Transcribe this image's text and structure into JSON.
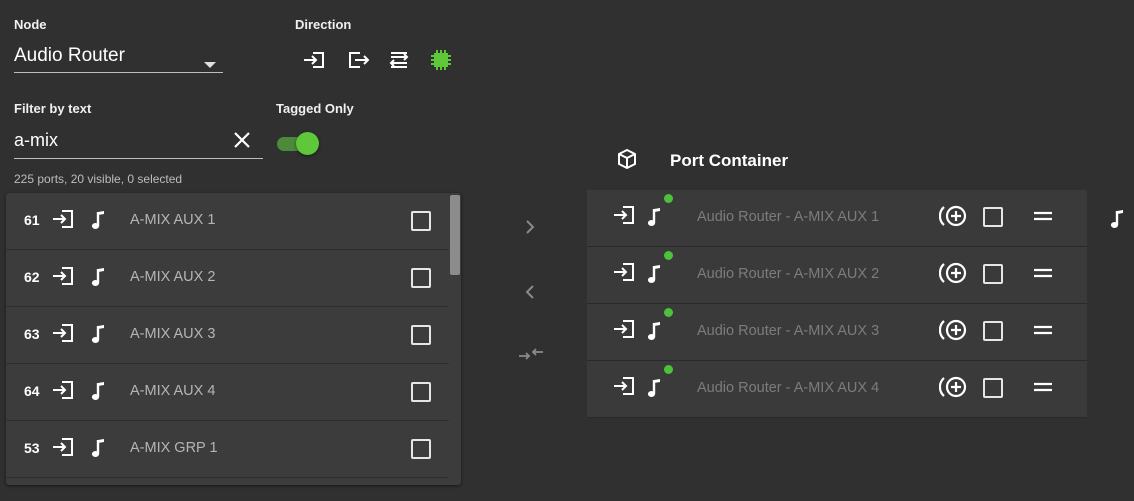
{
  "node": {
    "label": "Node",
    "value": "Audio Router"
  },
  "direction": {
    "label": "Direction",
    "options": [
      "input-icon",
      "output-icon",
      "bidirectional-icon",
      "chip-icon"
    ]
  },
  "filter": {
    "label": "Filter by text",
    "value": "a-mix"
  },
  "tagged_only": {
    "label": "Tagged Only",
    "on": true
  },
  "summary": "225 ports, 20 visible, 0 selected",
  "left_list": [
    {
      "number": "61",
      "name": "A-MIX AUX 1"
    },
    {
      "number": "62",
      "name": "A-MIX AUX 2"
    },
    {
      "number": "63",
      "name": "A-MIX AUX 3"
    },
    {
      "number": "64",
      "name": "A-MIX AUX 4"
    },
    {
      "number": "53",
      "name": "A-MIX GRP 1"
    }
  ],
  "port_container": {
    "title": "Port Container",
    "rows": [
      {
        "name": "Audio Router - A-MIX AUX 1"
      },
      {
        "name": "Audio Router - A-MIX AUX 2"
      },
      {
        "name": "Audio Router - A-MIX AUX 3"
      },
      {
        "name": "Audio Router - A-MIX AUX 4"
      }
    ]
  },
  "colors": {
    "accent": "#5fc83a",
    "background": "#303030",
    "panel": "#3c3c3c",
    "status_dot": "#4cc13a"
  }
}
